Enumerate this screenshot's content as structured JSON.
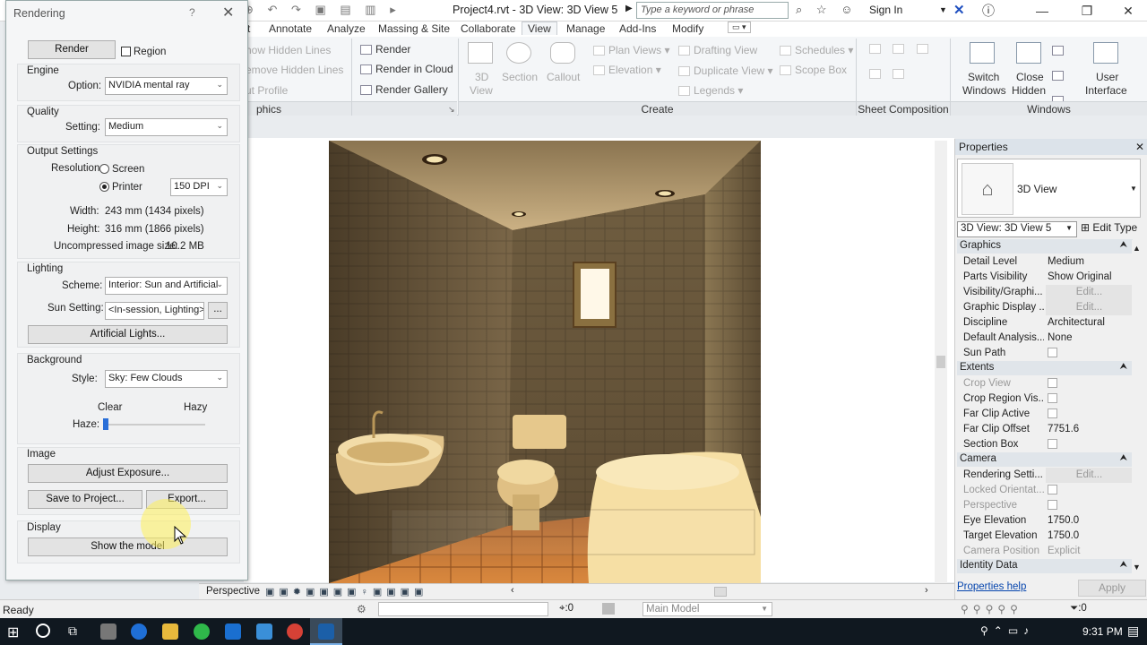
{
  "titlebar": {
    "title": "Project4.rvt - 3D View: 3D View 5",
    "search_placeholder": "Type a keyword or phrase",
    "sign_in": "Sign In",
    "minimize": "—",
    "maximize": "❐",
    "close": "✕"
  },
  "ribbon": {
    "tabs": [
      "t",
      "Annotate",
      "Analyze",
      "Massing & Site",
      "Collaborate",
      "View",
      "Manage",
      "Add-Ins",
      "Modify"
    ],
    "active_tab": "View",
    "graphics": {
      "items": [
        "how  Hidden Lines",
        "emove  Hidden Lines",
        "ut  Profile"
      ],
      "label": "phics"
    },
    "presentation": {
      "render": "Render",
      "render_cloud": "Render  in Cloud",
      "render_gallery": "Render  Gallery"
    },
    "create": {
      "view3d": "3D",
      "view3d_sub": "View",
      "section": "Section",
      "callout": "Callout",
      "plan_views": "Plan  Views",
      "elevation": "Elevation",
      "drafting_view": "Drafting  View",
      "duplicate_view": "Duplicate  View",
      "legends": "Legends",
      "schedules": "Schedules",
      "scope_box": "Scope  Box",
      "label": "Create"
    },
    "sheet_composition": {
      "label": "Sheet Composition"
    },
    "windows": {
      "switch_windows": "Switch",
      "switch_windows_sub": "Windows",
      "close_hidden": "Close",
      "close_hidden_sub": "Hidden",
      "user_interface": "User",
      "user_interface_sub": "Interface",
      "label": "Windows"
    }
  },
  "dialog": {
    "title": "Rendering",
    "help": "?",
    "close": "✕",
    "render_button": "Render",
    "region_label": "Region",
    "engine": {
      "group": "Engine",
      "option_label": "Option:",
      "option_value": "NVIDIA mental ray"
    },
    "quality": {
      "group": "Quality",
      "setting_label": "Setting:",
      "setting_value": "Medium"
    },
    "output": {
      "group": "Output Settings",
      "resolution_label": "Resolution:",
      "screen": "Screen",
      "printer": "Printer",
      "dpi": "150 DPI",
      "width_label": "Width:",
      "width_value": "243 mm (1434 pixels)",
      "height_label": "Height:",
      "height_value": "316 mm (1866 pixels)",
      "size_label": "Uncompressed image size:",
      "size_value": "10.2 MB"
    },
    "lighting": {
      "group": "Lighting",
      "scheme_label": "Scheme:",
      "scheme_value": "Interior: Sun and Artificial",
      "sun_label": "Sun Setting:",
      "sun_value": "<In-session, Lighting>",
      "browse": "...",
      "artificial_lights": "Artificial Lights..."
    },
    "background": {
      "group": "Background",
      "style_label": "Style:",
      "style_value": "Sky: Few Clouds",
      "clear": "Clear",
      "hazy": "Hazy",
      "haze_label": "Haze:",
      "haze_level": 0
    },
    "image": {
      "group": "Image",
      "adjust_exposure": "Adjust Exposure...",
      "save_to_project": "Save to Project...",
      "export": "Export..."
    },
    "display": {
      "group": "Display",
      "show_model": "Show the model"
    }
  },
  "view": {
    "view_label": "Perspective"
  },
  "properties": {
    "header": "Properties",
    "close": "✕",
    "type_name": "3D View",
    "selector": "3D View: 3D View 5",
    "edit_type": "Edit Type",
    "sections": [
      {
        "name": "Graphics",
        "rows": [
          {
            "key": "Detail Level",
            "value": "Medium"
          },
          {
            "key": "Parts Visibility",
            "value": "Show Original"
          },
          {
            "key": "Visibility/Graphi...",
            "value": "Edit...",
            "button": true
          },
          {
            "key": "Graphic Display ...",
            "value": "Edit...",
            "button": true
          },
          {
            "key": "Discipline",
            "value": "Architectural"
          },
          {
            "key": "Default Analysis...",
            "value": "None"
          },
          {
            "key": "Sun Path",
            "value": "",
            "checkbox": true
          }
        ]
      },
      {
        "name": "Extents",
        "rows": [
          {
            "key": "Crop View",
            "value": "",
            "checkbox": true,
            "dim": true
          },
          {
            "key": "Crop Region Vis...",
            "value": "",
            "checkbox": true
          },
          {
            "key": "Far Clip Active",
            "value": "",
            "checkbox": true
          },
          {
            "key": "Far Clip Offset",
            "value": "7751.6"
          },
          {
            "key": "Section Box",
            "value": "",
            "checkbox": true
          }
        ]
      },
      {
        "name": "Camera",
        "rows": [
          {
            "key": "Rendering Setti...",
            "value": "Edit...",
            "button": true
          },
          {
            "key": "Locked Orientat...",
            "value": "",
            "checkbox": true,
            "dim": true
          },
          {
            "key": "Perspective",
            "value": "",
            "checkbox": true,
            "dim": true
          },
          {
            "key": "Eye Elevation",
            "value": "1750.0"
          },
          {
            "key": "Target Elevation",
            "value": "1750.0"
          },
          {
            "key": "Camera Position",
            "value": "Explicit",
            "dim": true
          }
        ]
      },
      {
        "name": "Identity Data",
        "rows": []
      }
    ],
    "help_link": "Properties help",
    "apply": "Apply"
  },
  "statusbar": {
    "ready": "Ready",
    "zero1": ":0",
    "model": "Main Model",
    "zero2": ":0"
  },
  "taskbar": {
    "time": "9:31 PM"
  }
}
